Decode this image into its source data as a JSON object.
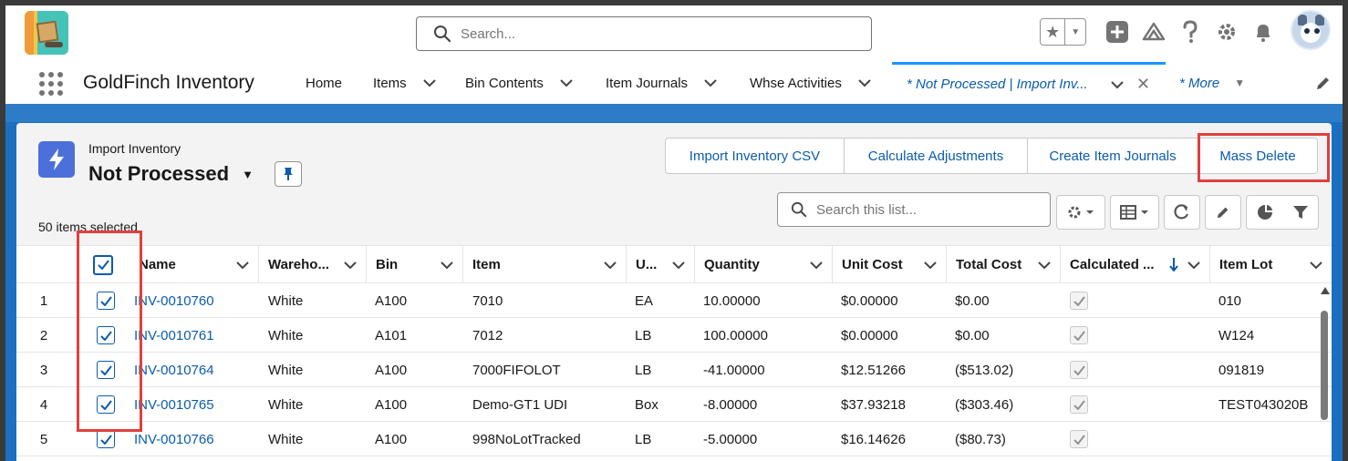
{
  "header": {
    "search_placeholder": "Search...",
    "icons": [
      "star-icon",
      "add-icon",
      "trailhead-icon",
      "help-icon",
      "gear-icon",
      "bell-icon"
    ]
  },
  "nav": {
    "app_name": "GoldFinch Inventory",
    "items": [
      {
        "label": "Home",
        "has_menu": false
      },
      {
        "label": "Items",
        "has_menu": true
      },
      {
        "label": "Bin Contents",
        "has_menu": true
      },
      {
        "label": "Item Journals",
        "has_menu": true
      },
      {
        "label": "Whse Activities",
        "has_menu": true
      }
    ],
    "active_tab": "* Not Processed | Import Inv...",
    "more": "* More"
  },
  "list": {
    "object_label": "Import Inventory",
    "view_name": "Not Processed",
    "selected_text": "50 items selected",
    "search_placeholder": "Search this list...",
    "actions": [
      "Import Inventory CSV",
      "Calculate Adjustments",
      "Create Item Journals",
      "Mass Delete"
    ],
    "highlight_color": "#e0403e"
  },
  "table": {
    "columns": [
      "Name",
      "Wareho...",
      "Bin",
      "Item",
      "U...",
      "Quantity",
      "Unit Cost",
      "Total Cost",
      "Calculated ...",
      "Item Lot"
    ],
    "sorted_column": "Calculated ...",
    "rows": [
      {
        "num": "1",
        "name": "INV-0010760",
        "warehouse": "White",
        "bin": "A100",
        "item": "7010",
        "uom": "EA",
        "quantity": "10.00000",
        "unit_cost": "$0.00000",
        "total_cost": "$0.00",
        "calculated": true,
        "item_lot": "010"
      },
      {
        "num": "2",
        "name": "INV-0010761",
        "warehouse": "White",
        "bin": "A101",
        "item": "7012",
        "uom": "LB",
        "quantity": "100.00000",
        "unit_cost": "$0.00000",
        "total_cost": "$0.00",
        "calculated": true,
        "item_lot": "W124"
      },
      {
        "num": "3",
        "name": "INV-0010764",
        "warehouse": "White",
        "bin": "A100",
        "item": "7000FIFOLOT",
        "uom": "LB",
        "quantity": "-41.00000",
        "unit_cost": "$12.51266",
        "total_cost": "($513.02)",
        "calculated": true,
        "item_lot": "091819"
      },
      {
        "num": "4",
        "name": "INV-0010765",
        "warehouse": "White",
        "bin": "A100",
        "item": "Demo-GT1 UDI",
        "uom": "Box",
        "quantity": "-8.00000",
        "unit_cost": "$37.93218",
        "total_cost": "($303.46)",
        "calculated": true,
        "item_lot": "TEST043020B"
      },
      {
        "num": "5",
        "name": "INV-0010766",
        "warehouse": "White",
        "bin": "A100",
        "item": "998NoLotTracked",
        "uom": "LB",
        "quantity": "-5.00000",
        "unit_cost": "$16.14626",
        "total_cost": "($80.73)",
        "calculated": true,
        "item_lot": ""
      }
    ]
  }
}
